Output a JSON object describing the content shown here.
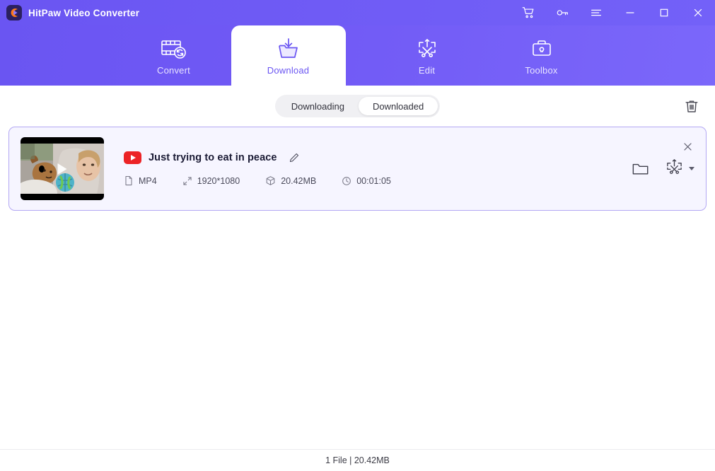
{
  "titlebar": {
    "app_title": "HitPaw Video Converter",
    "logo_icon": "hitpaw-logo-icon",
    "controls": [
      {
        "name": "cart-icon",
        "label": "Cart"
      },
      {
        "name": "key-icon",
        "label": "Register"
      },
      {
        "name": "menu-icon",
        "label": "Menu"
      },
      {
        "name": "minimize-icon",
        "label": "Minimize"
      },
      {
        "name": "maximize-icon",
        "label": "Maximize"
      },
      {
        "name": "close-icon",
        "label": "Close"
      }
    ]
  },
  "nav": {
    "tabs": [
      {
        "label": "Convert",
        "icon": "convert-icon",
        "active": false
      },
      {
        "label": "Download",
        "icon": "download-icon",
        "active": true
      },
      {
        "label": "Edit",
        "icon": "edit-icon",
        "active": false
      },
      {
        "label": "Toolbox",
        "icon": "toolbox-icon",
        "active": false
      }
    ]
  },
  "subbar": {
    "segments": [
      {
        "label": "Downloading",
        "active": false
      },
      {
        "label": "Downloaded",
        "active": true
      }
    ],
    "delete_all_icon": "trash-icon"
  },
  "files": [
    {
      "title": "Just trying to eat in peace",
      "source_icon": "youtube-icon",
      "edit_title_icon": "pencil-icon",
      "thumbnail_play_icon": "play-icon",
      "meta": [
        {
          "icon": "file-icon",
          "value": "MP4"
        },
        {
          "icon": "resolution-icon",
          "value": "1920*1080"
        },
        {
          "icon": "size-icon",
          "value": "20.42MB"
        },
        {
          "icon": "duration-icon",
          "value": "00:01:05"
        }
      ],
      "actions": [
        {
          "icon": "folder-icon",
          "label": "Open folder"
        },
        {
          "icon": "edit-video-icon",
          "label": "Edit"
        }
      ],
      "remove_icon": "close-icon"
    }
  ],
  "statusbar": {
    "summary": "1 File | 20.42MB"
  },
  "colors": {
    "brand_purple": "#6a55f2",
    "card_border": "#b3a7f3",
    "card_bg": "#f6f5ff",
    "youtube_red": "#ec2326",
    "text_dark": "#1b1b35"
  }
}
